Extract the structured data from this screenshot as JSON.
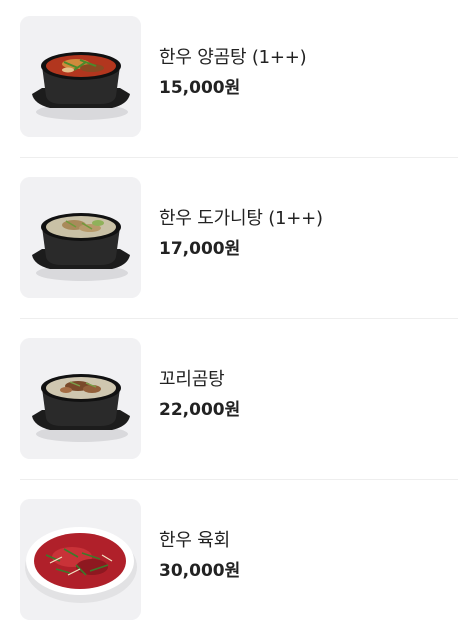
{
  "menu": {
    "items": [
      {
        "name": "한우 양곰탕 (1++)",
        "price": "15,000원",
        "image": "beef-tripe-soup-in-stone-pot"
      },
      {
        "name": "한우 도가니탕 (1++)",
        "price": "17,000원",
        "image": "ox-knee-soup-in-stone-pot"
      },
      {
        "name": "꼬리곰탕",
        "price": "22,000원",
        "image": "oxtail-soup-in-stone-pot"
      },
      {
        "name": "한우 육회",
        "price": "30,000원",
        "image": "beef-tartare-on-plate"
      }
    ]
  },
  "colors": {
    "text": "#222222",
    "thumb_background": "#f1f1f3",
    "divider": "#eeeeee"
  }
}
